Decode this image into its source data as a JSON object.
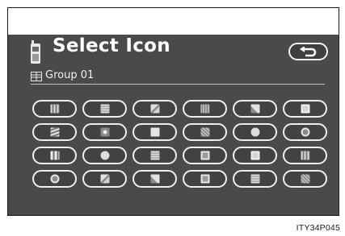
{
  "header": {
    "title": "Select Icon",
    "back_icon": "return-arrow-icon",
    "phone_icon": "phone-icon"
  },
  "group": {
    "label": "Group 01",
    "icon": "group-book-icon"
  },
  "caption": "ITY34P045",
  "colors": {
    "screen_bg": "#4a4a4a",
    "button_border": "#eeeeee",
    "text": "#ffffff"
  },
  "icons": [
    {
      "name": "building-icon",
      "style": "grid"
    },
    {
      "name": "document-icon",
      "style": "lines"
    },
    {
      "name": "landscape-icon",
      "style": "diag"
    },
    {
      "name": "city-icon",
      "style": "bars"
    },
    {
      "name": "road-icon",
      "style": "diag2"
    },
    {
      "name": "notebook-icon",
      "style": "box"
    },
    {
      "name": "wave-icon",
      "style": "waves"
    },
    {
      "name": "flower-icon",
      "style": "dots"
    },
    {
      "name": "page-icon",
      "style": "solid"
    },
    {
      "name": "texture-icon",
      "style": "hatch"
    },
    {
      "name": "heart-icon",
      "style": "round"
    },
    {
      "name": "gear-icon",
      "style": "ring"
    },
    {
      "name": "columns-icon",
      "style": "cols"
    },
    {
      "name": "globe-icon",
      "style": "round"
    },
    {
      "name": "picture-icon",
      "style": "lines"
    },
    {
      "name": "frame-icon",
      "style": "frame"
    },
    {
      "name": "photo-icon",
      "style": "box"
    },
    {
      "name": "person-icon",
      "style": "grid"
    },
    {
      "name": "compass-icon",
      "style": "ring"
    },
    {
      "name": "mountain-icon",
      "style": "diag"
    },
    {
      "name": "tools-icon",
      "style": "diag2"
    },
    {
      "name": "flag-icon",
      "style": "frame"
    },
    {
      "name": "sign-icon",
      "style": "lines"
    },
    {
      "name": "pattern-icon",
      "style": "hatch"
    }
  ]
}
